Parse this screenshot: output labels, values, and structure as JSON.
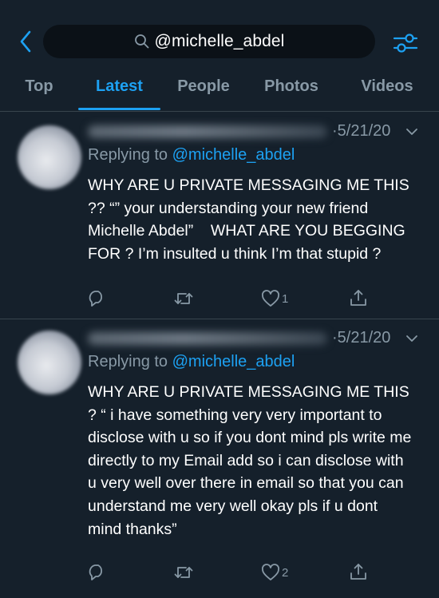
{
  "search": {
    "query": "@michelle_abdel"
  },
  "tabs": [
    {
      "label": "Top"
    },
    {
      "label": "Latest"
    },
    {
      "label": "People"
    },
    {
      "label": "Photos"
    },
    {
      "label": "Videos"
    }
  ],
  "active_tab": "Latest",
  "colors": {
    "background": "#15202b",
    "accent": "#1da1f2",
    "muted": "#8899a6",
    "divider": "#38444d"
  },
  "tweets": [
    {
      "date": "·5/21/20",
      "replying_prefix": "Replying to ",
      "replying_handle": "@michelle_abdel",
      "text": "WHY ARE U PRIVATE MESSAGING ME THIS ?? “” your understanding your new friend Michelle Abdel”    WHAT ARE YOU BEGGING FOR ? I’m insulted u think I’m that stupid ?",
      "like_count": "1"
    },
    {
      "date": "·5/21/20",
      "replying_prefix": "Replying to ",
      "replying_handle": "@michelle_abdel",
      "text": "WHY ARE U PRIVATE MESSAGING ME THIS ? “ i have something very very important to disclose with u so if you dont mind pls write me directly to my Email add so i can disclose with u very well over there in email so that you can understand me very well okay pls if u dont mind thanks”",
      "like_count": "2"
    }
  ]
}
